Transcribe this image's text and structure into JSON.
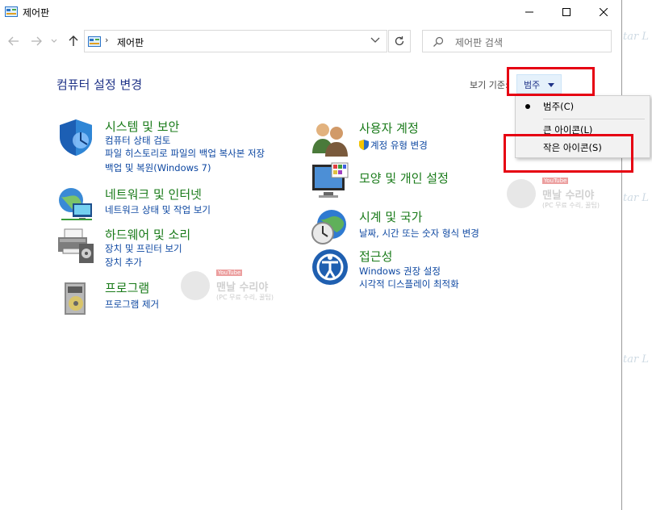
{
  "window": {
    "title": "제어판"
  },
  "address": {
    "path": "제어판",
    "search_placeholder": "제어판 검색"
  },
  "content": {
    "heading": "컴퓨터 설정 변경",
    "view_by_label": "보기 기준:",
    "view_by_value": "범주"
  },
  "categories": [
    {
      "title": "시스템 및 보안",
      "links": [
        "컴퓨터 상태 검토",
        "파일 히스토리로 파일의 백업 복사본 저장",
        "백업 및 복원(Windows 7)"
      ],
      "icon": "shield-icon"
    },
    {
      "title": "네트워크 및 인터넷",
      "links": [
        "네트워크 상태 및 작업 보기"
      ],
      "icon": "network-globe-icon"
    },
    {
      "title": "하드웨어 및 소리",
      "links": [
        "장치 및 프린터 보기",
        "장치 추가"
      ],
      "icon": "printer-icon"
    },
    {
      "title": "프로그램",
      "links": [
        "프로그램 제거"
      ],
      "icon": "programs-disc-icon"
    },
    {
      "title": "사용자 계정",
      "links": [
        "계정 유형 변경"
      ],
      "icon": "users-icon"
    },
    {
      "title": "모양 및 개인 설정",
      "links": [],
      "icon": "monitor-icon"
    },
    {
      "title": "시계 및 국가",
      "links": [
        "날짜, 시간 또는 숫자 형식 변경"
      ],
      "icon": "clock-globe-icon"
    },
    {
      "title": "접근성",
      "links": [
        "Windows 권장 설정",
        "시각적 디스플레이 최적화"
      ],
      "icon": "accessibility-icon"
    }
  ],
  "view_menu": {
    "items": [
      "범주(C)",
      "큰 아이콘(L)",
      "작은 아이콘(S)"
    ],
    "selected": "범주(C)"
  },
  "watermark": {
    "badge": "YouTube",
    "name": "맨날 수리야",
    "sub": "(PC 무료 수리, 꿀팁)",
    "star": "tar L"
  },
  "colors": {
    "heading": "#1e3287",
    "category_title": "#1a7b1a",
    "link": "#0d47a1",
    "highlight": "#e60012"
  }
}
